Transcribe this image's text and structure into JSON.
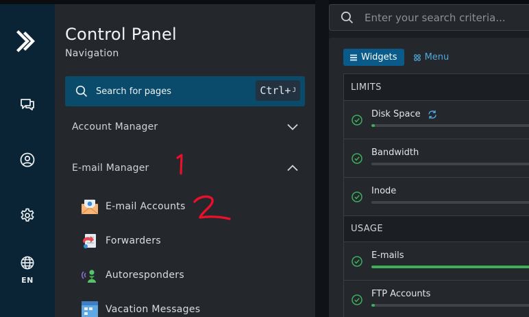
{
  "rail": {
    "items": [
      {
        "icon": "logo-icon"
      },
      {
        "icon": "chat-icon"
      },
      {
        "icon": "user-icon"
      },
      {
        "icon": "gear-icon"
      },
      {
        "icon": "globe-icon",
        "label": "EN"
      }
    ]
  },
  "nav": {
    "title": "Control Panel",
    "subtitle": "Navigation",
    "search": {
      "label": "Search for pages",
      "shortcut": "Ctrl+",
      "shortcut_key": "J"
    },
    "sections": [
      {
        "label": "Account Manager",
        "expanded": false
      },
      {
        "label": "E-mail Manager",
        "expanded": true
      }
    ],
    "items": [
      {
        "label": "E-mail Accounts",
        "icon": "email-accounts-icon"
      },
      {
        "label": "Forwarders",
        "icon": "forwarders-icon"
      },
      {
        "label": "Autoresponders",
        "icon": "autoresponders-icon"
      },
      {
        "label": "Vacation Messages",
        "icon": "vacation-messages-icon"
      }
    ],
    "annotations": [
      "1",
      "2"
    ]
  },
  "content": {
    "search": {
      "placeholder": "Enter your search criteria..."
    },
    "tabs": {
      "active": "Widgets",
      "inactive": "Menu"
    },
    "groups": {
      "limits": {
        "header": "LIMITS",
        "rows": [
          {
            "label": "Disk Space",
            "progress": 0.02,
            "status": "ok",
            "refresh_icon": true
          },
          {
            "label": "Bandwidth",
            "progress": 0.0,
            "status": "ok"
          },
          {
            "label": "Inode",
            "progress": 0.0,
            "status": "ok"
          }
        ]
      },
      "usage": {
        "header": "USAGE",
        "rows": [
          {
            "label": "E-mails",
            "progress": 1.0,
            "status": "ok"
          },
          {
            "label": "FTP Accounts",
            "progress": 0.02,
            "status": "ok"
          }
        ]
      }
    }
  },
  "colors": {
    "rail_bg": "#0a2436",
    "nav_bg": "#24282d",
    "search_bg": "#0a4a6b",
    "accent": "#0a5a8a",
    "link": "#4ea8dd",
    "progress": "#3fae5a",
    "check": "#3fae5a",
    "annotation": "#e8102a"
  }
}
